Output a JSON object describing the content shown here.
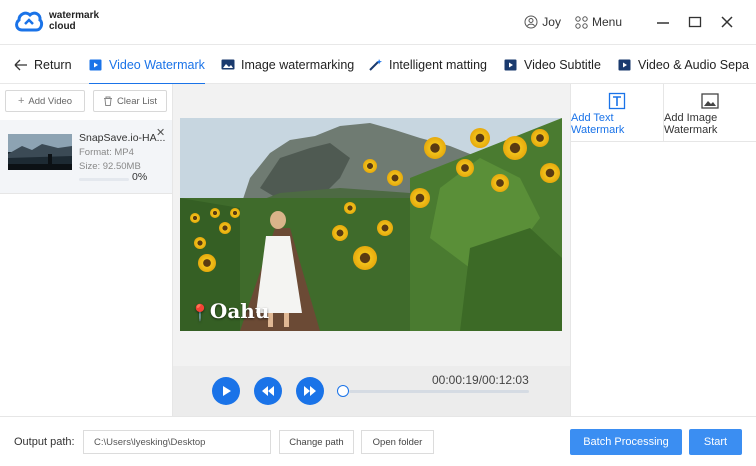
{
  "app": {
    "logo_line1": "watermark",
    "logo_line2": "cloud",
    "user": "Joy",
    "menu_label": "Menu"
  },
  "tabs": [
    {
      "label": "Return"
    },
    {
      "label": "Video Watermark",
      "active": true
    },
    {
      "label": "Image watermarking"
    },
    {
      "label": "Intelligent matting"
    },
    {
      "label": "Video Subtitle"
    },
    {
      "label": "Video & Audio Sepa"
    }
  ],
  "left": {
    "add_video": "Add Video",
    "clear_list": "Clear List",
    "file": {
      "name": "SnapSave.io-HA...",
      "format": "Format: MP4",
      "size": "Size: 92.50MB",
      "progress_text": "0%",
      "progress": 0
    }
  },
  "preview": {
    "watermark_text": "Oahu",
    "time": "00:00:19/00:12:03"
  },
  "right": {
    "tab_text_l1": "Add Text",
    "tab_text_l2": "Watermark",
    "tab_image_l1": "Add Image",
    "tab_image_l2": "Watermark"
  },
  "footer": {
    "output_label": "Output path:",
    "output_path": "C:\\Users\\lyesking\\Desktop",
    "change_path": "Change path",
    "open_folder": "Open folder",
    "batch": "Batch Processing",
    "start": "Start"
  },
  "colors": {
    "accent": "#1a73e8",
    "primary_button": "#3b8ef2"
  }
}
